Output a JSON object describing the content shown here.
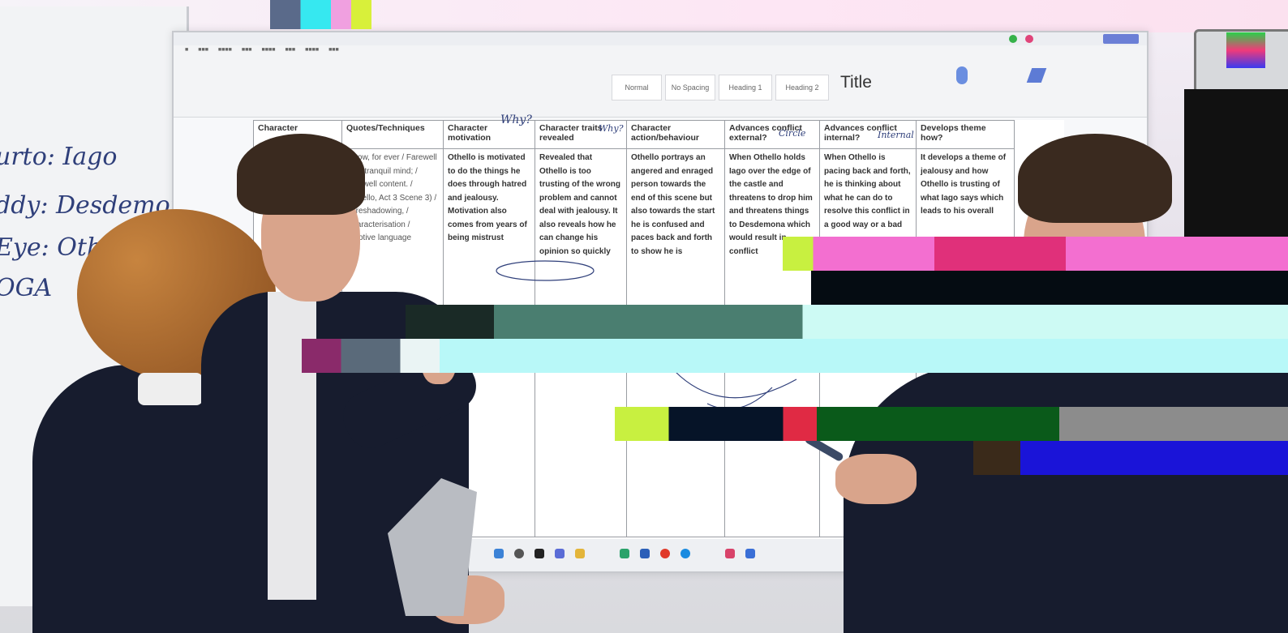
{
  "whiteboard": {
    "lines": [
      "urto: Iago",
      "ddy: Desdemona",
      "Eye: Othel",
      "OGA"
    ]
  },
  "word_app": {
    "title_style_label": "Title",
    "style_gallery": [
      "Normal",
      "No Spacing",
      "Heading 1",
      "Heading 2"
    ]
  },
  "table": {
    "headers": [
      "Character",
      "Quotes/Techniques",
      "Character motivation",
      "Character traits revealed",
      "Character action/behaviour",
      "Advances conflict external?",
      "Advances conflict internal?",
      "Develops theme how?"
    ],
    "cells": [
      "",
      "I, now, for ever / Farewell the / tranquil mind; / Farewell content. / (Othello, Act 3 Scene 3) / Foreshadowing, / Characterisation / Emotive language",
      "Othello is motivated to do the things he does through hatred and jealousy. Motivation also comes from years of being mistrust",
      "Revealed that Othello is too trusting of the wrong problem and cannot deal with jealousy. It also reveals how he can change his opinion so quickly",
      "Othello portrays an angered and enraged person towards the end of this scene but also towards the start he is confused and paces back and forth to show he is",
      "When Othello holds Iago over the edge of the castle and threatens to drop him and threatens things to Desdemona which would result in conflict",
      "When Othello is pacing back and forth, he is thinking about what he can do to resolve this conflict in a good way or a bad",
      "It develops a theme of jealousy and how Othello is trusting of what Iago says which leads to his overall"
    ],
    "annotations": [
      "Why?",
      "Why?",
      "Circle",
      "Internal"
    ]
  },
  "colors": {
    "blazer": "#171c2e",
    "marker": "#2f3f7a",
    "glitch_pink": "#f36fd0",
    "glitch_green": "#0a5a1a",
    "glitch_blue": "#1a14d8"
  }
}
